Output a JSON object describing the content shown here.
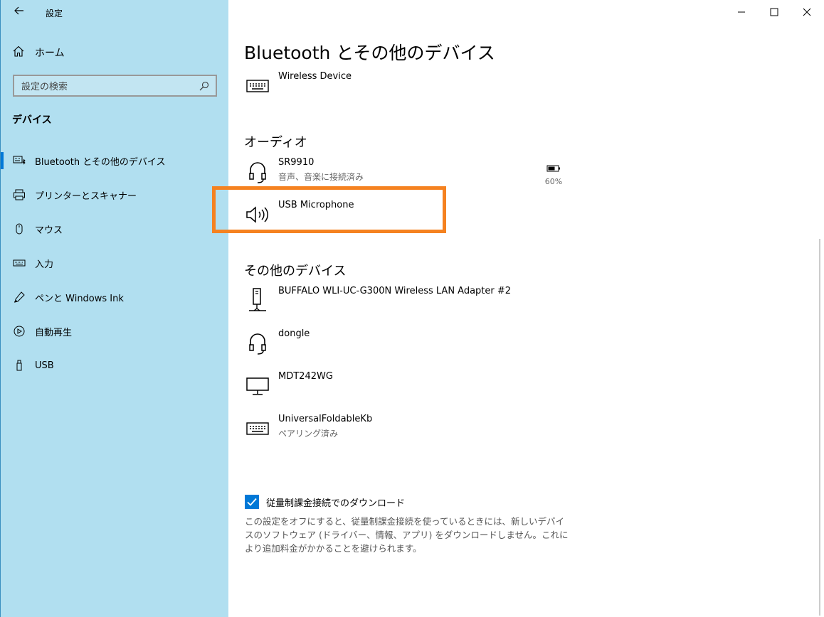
{
  "titlebar": {
    "title": "設定",
    "back_icon": "arrow-left-icon"
  },
  "window_controls": {
    "minimize_icon": "minimize-icon",
    "maximize_icon": "maximize-icon",
    "close_icon": "close-icon"
  },
  "sidebar": {
    "home_label": "ホーム",
    "search_placeholder": "設定の検索",
    "section_label": "デバイス",
    "items": [
      {
        "label": "Bluetooth とその他のデバイス",
        "icon": "keyboard-bluetooth-icon",
        "active": true
      },
      {
        "label": "プリンターとスキャナー",
        "icon": "printer-icon"
      },
      {
        "label": "マウス",
        "icon": "mouse-icon"
      },
      {
        "label": "入力",
        "icon": "keyboard-icon"
      },
      {
        "label": "ペンと Windows Ink",
        "icon": "pen-icon"
      },
      {
        "label": "自動再生",
        "icon": "autoplay-icon"
      },
      {
        "label": "USB",
        "icon": "usb-icon"
      }
    ]
  },
  "main": {
    "title": "Bluetooth とその他のデバイス",
    "input_devices": [
      {
        "name": "Wireless Device",
        "icon": "keyboard-icon"
      }
    ],
    "audio_header": "オーディオ",
    "audio_devices": [
      {
        "name": "SR9910",
        "status": "音声、音楽に接続済み",
        "icon": "headset-icon",
        "battery": "60%"
      },
      {
        "name": "USB Microphone",
        "icon": "speaker-icon"
      }
    ],
    "other_header": "その他のデバイス",
    "other_devices": [
      {
        "name": "BUFFALO WLI-UC-G300N Wireless LAN Adapter #2",
        "icon": "usb-network-adapter-icon"
      },
      {
        "name": "dongle",
        "icon": "headset-icon"
      },
      {
        "name": "MDT242WG",
        "icon": "monitor-icon"
      },
      {
        "name": "UniversalFoldableKb",
        "status": "ペアリング済み",
        "icon": "keyboard-icon"
      }
    ],
    "metered_checkbox": {
      "label": "従量制課金接続でのダウンロード",
      "checked": true
    },
    "metered_description": "この設定をオフにすると、従量制課金接続を使っているときには、新しいデバイスのソフトウェア (ドライバー、情報、アプリ) をダウンロードしません。これにより追加料金がかかることを避けられます。"
  },
  "colors": {
    "sidebar_bg": "#b1dff0",
    "accent": "#0078d7",
    "highlight_border": "#f58220"
  }
}
